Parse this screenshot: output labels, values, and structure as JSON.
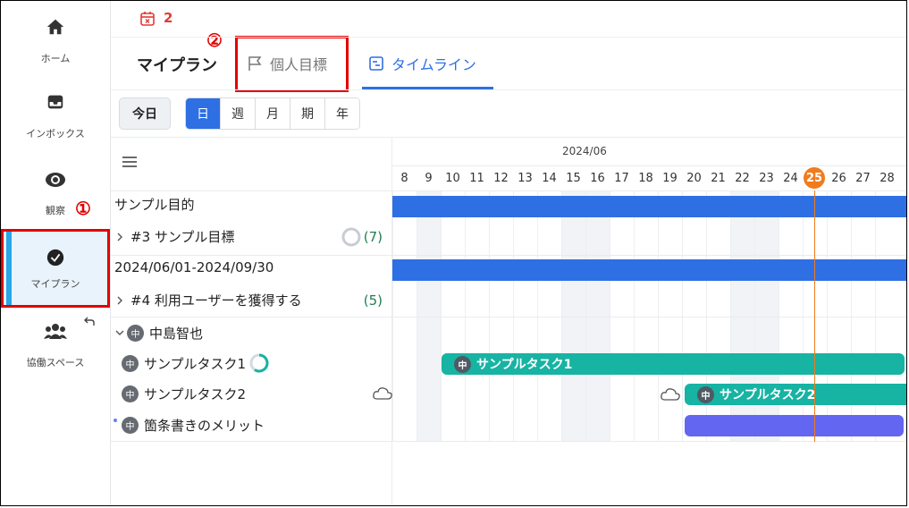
{
  "sidebar": {
    "items": [
      {
        "label": "ホーム",
        "icon": "home-icon"
      },
      {
        "label": "インボックス",
        "icon": "inbox-icon"
      },
      {
        "label": "観察",
        "icon": "eye-icon"
      },
      {
        "label": "マイプラン",
        "icon": "check-circle-icon",
        "active": true
      },
      {
        "label": "協働スペース",
        "icon": "group-icon"
      }
    ]
  },
  "topbar": {
    "calendar_count": "2"
  },
  "header": {
    "title": "マイプラン",
    "tabs": [
      {
        "label": "個人目標",
        "icon": "flag-icon"
      },
      {
        "label": "タイムライン",
        "icon": "timeline-icon",
        "active": true
      }
    ]
  },
  "toolbar": {
    "today_label": "今日",
    "scales": [
      "日",
      "週",
      "月",
      "期",
      "年"
    ],
    "selected_scale": "日"
  },
  "annotations": {
    "mark1": "①",
    "mark2": "②"
  },
  "list": {
    "goal_title": "サンプル目的",
    "goal_item": "#3 サンプル目標",
    "goal_count": "(7)",
    "period": "2024/06/01-2024/09/30",
    "target_item": "#4 利用ユーザーを獲得する",
    "target_count": "(5)",
    "member": "中島智也",
    "avatar_char": "中",
    "tasks": [
      "サンプルタスク1",
      "サンプルタスク2",
      "箇条書きのメリット"
    ]
  },
  "gantt": {
    "month": "2024/06",
    "days": [
      "8",
      "9",
      "10",
      "11",
      "12",
      "13",
      "14",
      "15",
      "16",
      "17",
      "18",
      "19",
      "20",
      "21",
      "22",
      "23",
      "24",
      "25",
      "26",
      "27",
      "28"
    ],
    "today": "25",
    "bars": [
      {
        "label": "サンプルタスク1",
        "color": "#17b3a3"
      },
      {
        "label": "サンプルタスク2",
        "color": "#17b3a3"
      },
      {
        "label": "",
        "color": "#6366f1"
      }
    ],
    "goal_bar_color": "#2f6fe4"
  }
}
